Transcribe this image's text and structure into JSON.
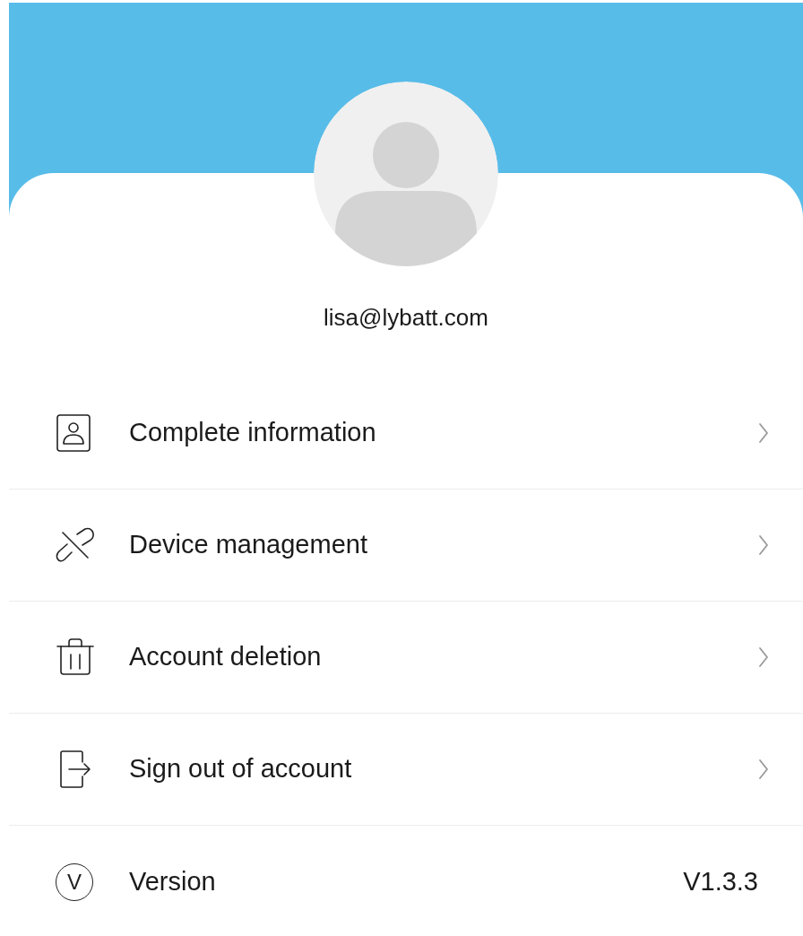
{
  "profile": {
    "email": "lisa@lybatt.com"
  },
  "menu": [
    {
      "kind": "link",
      "label": "Complete information"
    },
    {
      "kind": "link",
      "label": "Device management"
    },
    {
      "kind": "link",
      "label": "Account deletion"
    },
    {
      "kind": "link",
      "label": "Sign out of account"
    },
    {
      "kind": "info",
      "icon_text": "V",
      "label": "Version",
      "value": "V1.3.3"
    }
  ]
}
